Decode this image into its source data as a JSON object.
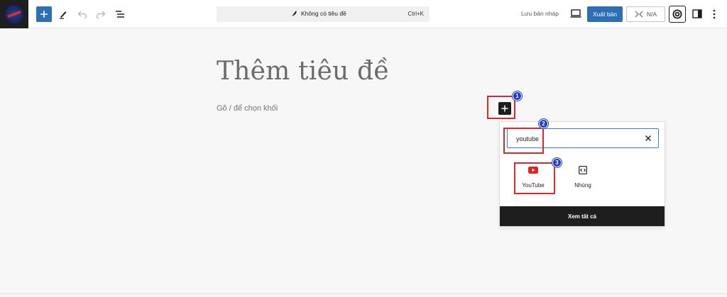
{
  "toolbar": {
    "add_block_label": "Add block",
    "document_title": "Không có tiêu đề",
    "command_shortcut": "Ctrl+K",
    "save_draft": "Lưu bản nháp",
    "publish": "Xuất bản",
    "seo_score": "N/A"
  },
  "editor": {
    "title_placeholder": "Thêm tiêu đề",
    "block_placeholder": "Gõ / để chọn khối"
  },
  "inserter": {
    "search_value": "youtube",
    "results": [
      {
        "label": "YouTube",
        "icon": "youtube-icon"
      },
      {
        "label": "Nhúng",
        "icon": "embed-icon"
      }
    ],
    "browse_all": "Xem tất cả"
  },
  "annotations": {
    "steps": [
      "1",
      "2",
      "3"
    ],
    "highlight_color": "#d9292f",
    "badge_color": "#1e3cc8"
  },
  "colors": {
    "accent": "#2c6fb7",
    "youtube_red": "#e62117"
  }
}
